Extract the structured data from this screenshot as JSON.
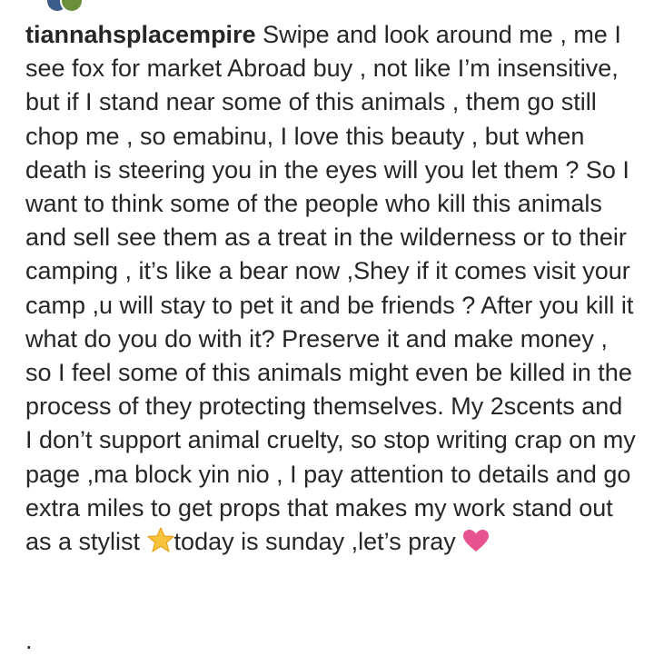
{
  "comment": {
    "username": "tiannahsplacempire",
    "text_before_star": "Swipe and look around me , me I see fox for market Abroad buy , not like I’m insensitive, but if I stand near some of this animals , them go still chop me , so emabinu, I love this beauty , but when death is steering you in the eyes will you let them ? So I want to think some of the people who kill this animals and sell see them as a treat in the wilderness or to their camping , it’s like a bear now ,Shey if it comes visit your camp ,u will stay to pet it and be friends ? After you kill it what do you do with it? Preserve it and make money , so I feel some of this animals might even be killed in the process of they protecting themselves. My 2scents and I don’t support animal cruelty, so stop writing crap on my page ,ma block yin nio , I pay attention to details and go extra miles to get props that makes my work stand out as a stylist ",
    "text_after_star": "today is sunday ,let’s pray ",
    "trailing": "."
  },
  "icons": {
    "star": "star-emoji-icon",
    "heart": "pink-heart-emoji-icon"
  },
  "colors": {
    "text": "#262626",
    "star_fill": "#f7c23c",
    "star_stroke": "#e8a21c",
    "heart": "#e8538f"
  }
}
